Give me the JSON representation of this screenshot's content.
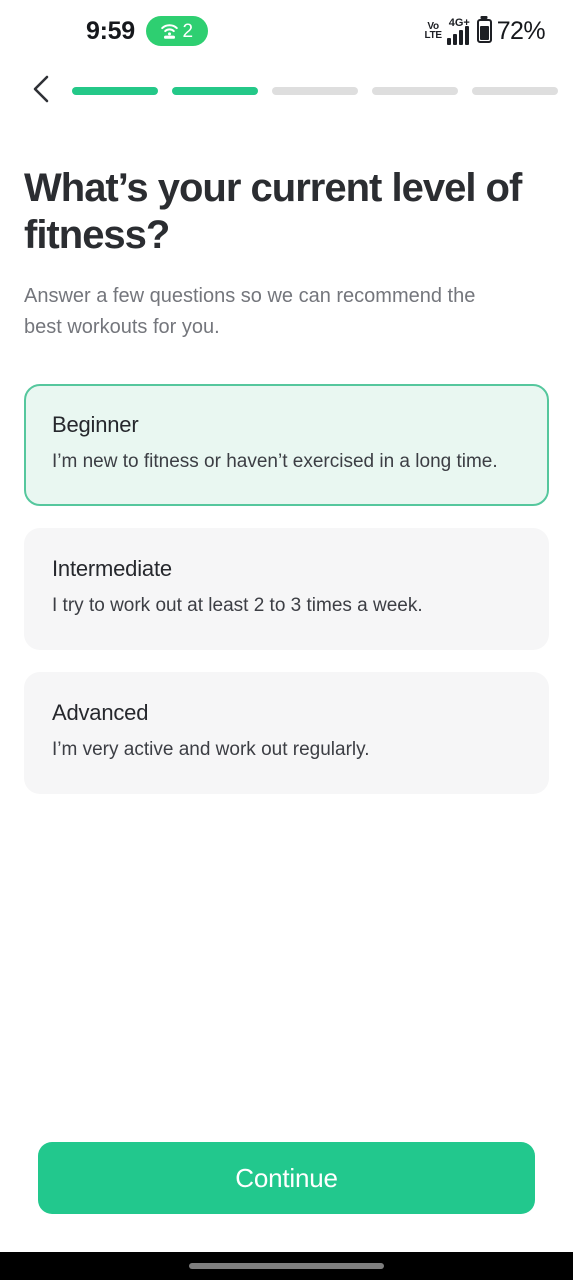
{
  "status_bar": {
    "time": "9:59",
    "hotspot_count": "2",
    "hotspot_icon": "hotspot-icon",
    "volte_top": "Vo",
    "volte_bottom": "LTE",
    "network_label": "4G+",
    "battery_percent": "72%"
  },
  "nav": {
    "back_icon": "chevron-left-icon",
    "progress": {
      "total_steps": 5,
      "completed_steps": 2,
      "segments": [
        "done",
        "done",
        "todo",
        "todo",
        "todo"
      ]
    }
  },
  "main": {
    "title": "What’s your current level of fitness?",
    "subtitle": "Answer a few questions so we can recommend the best workouts for you.",
    "options": [
      {
        "id": "beginner",
        "title": "Beginner",
        "description": "I’m new to fitness or haven’t exercised in a long time.",
        "selected": true
      },
      {
        "id": "intermediate",
        "title": "Intermediate",
        "description": "I try to work out at least 2 to 3 times a week.",
        "selected": false
      },
      {
        "id": "advanced",
        "title": "Advanced",
        "description": "I’m very active and work out regularly.",
        "selected": false
      }
    ]
  },
  "footer": {
    "continue_label": "Continue"
  },
  "colors": {
    "accent_green": "#22c88d",
    "progress_green": "#24c888",
    "hotspot_green": "#2ecf71",
    "selected_card_bg": "#e9f7f1",
    "selected_card_border": "#55c79d",
    "card_bg": "#f6f6f7",
    "title_color": "#2b2d31",
    "subtitle_color": "#74767c",
    "gesture_bar_bg": "#000000"
  }
}
